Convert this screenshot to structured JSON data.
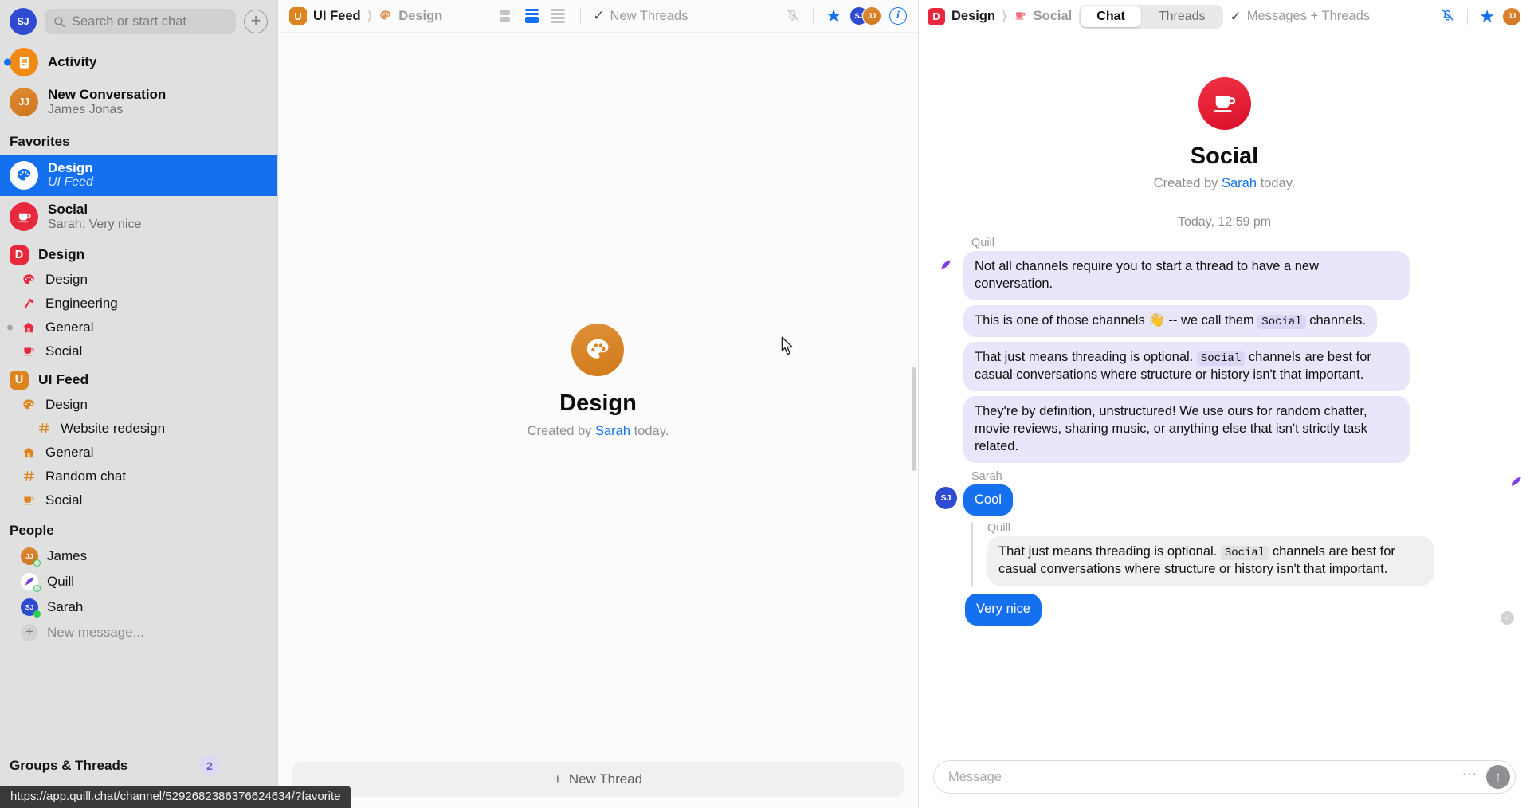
{
  "sidebar": {
    "user_avatar": "SJ",
    "search": {
      "placeholder": "Search or start chat",
      "icon": "search-icon"
    },
    "new_button": "+",
    "activity": {
      "label": "Activity",
      "icon": "activity-icon",
      "unread": true
    },
    "new_conversation": {
      "title": "New Conversation",
      "subtitle": "James Jonas",
      "avatar": "JJ"
    },
    "favorites_header": "Favorites",
    "favorites": [
      {
        "title": "Design",
        "subtitle": "UI Feed",
        "icon": "palette-icon",
        "selected": true
      },
      {
        "title": "Social",
        "subtitle": "Sarah: Very nice",
        "icon": "coffee-icon",
        "selected": false
      }
    ],
    "workspaces": [
      {
        "name": "Design",
        "badge": "D",
        "color": "#e8283c",
        "channels": [
          {
            "label": "Design",
            "icon": "palette-icon",
            "indent": false,
            "unread": false
          },
          {
            "label": "Engineering",
            "icon": "hammer-icon",
            "indent": false,
            "unread": false
          },
          {
            "label": "General",
            "icon": "home-icon",
            "indent": false,
            "unread": true
          },
          {
            "label": "Social",
            "icon": "coffee-icon",
            "indent": false,
            "unread": false
          }
        ]
      },
      {
        "name": "UI Feed",
        "badge": "U",
        "color": "#dd8420",
        "channels": [
          {
            "label": "Design",
            "icon": "palette-icon",
            "indent": false,
            "unread": false
          },
          {
            "label": "Website redesign",
            "icon": "hash-icon",
            "indent": true,
            "unread": false
          },
          {
            "label": "General",
            "icon": "home-icon",
            "indent": false,
            "unread": false
          },
          {
            "label": "Random chat",
            "icon": "hash-icon",
            "indent": false,
            "unread": false
          },
          {
            "label": "Social",
            "icon": "coffee-icon",
            "indent": false,
            "unread": false
          }
        ]
      }
    ],
    "people_header": "People",
    "people": [
      {
        "name": "James",
        "avatar": "JJ",
        "presence": "away"
      },
      {
        "name": "Quill",
        "avatar": "",
        "presence": "away"
      },
      {
        "name": "Sarah",
        "avatar": "SJ",
        "presence": "online"
      }
    ],
    "new_message": "New message...",
    "groups_threads": {
      "label": "Groups & Threads",
      "badge": "2"
    },
    "status_url": "https://app.quill.chat/channel/5292682386376624634/?favorite"
  },
  "center": {
    "breadcrumb": [
      {
        "label": "UI Feed",
        "badge": "U",
        "color": "#dd8420",
        "dim": false
      },
      {
        "label": "Design",
        "icon": "palette-icon",
        "dim": true
      }
    ],
    "layout_icons": [
      "layout-grid-icon",
      "layout-split-icon",
      "layout-list-icon"
    ],
    "filter": {
      "label": "New Threads",
      "icon": "check-icon"
    },
    "bell_icon": "bell-off-icon",
    "star_icon": "star-icon",
    "members": [
      "SJ",
      "JJ"
    ],
    "info_icon": "info-icon",
    "empty": {
      "title": "Design",
      "created_prefix": "Created by ",
      "created_by": "Sarah",
      "created_suffix": " today.",
      "icon": "palette-icon"
    },
    "new_thread_button": "New Thread"
  },
  "right": {
    "breadcrumb": [
      {
        "label": "Design",
        "badge": "D",
        "color": "#e8283c",
        "dim": false
      },
      {
        "label": "Social",
        "icon": "coffee-icon",
        "dim": true
      }
    ],
    "tabs": [
      {
        "label": "Chat",
        "active": true
      },
      {
        "label": "Threads",
        "active": false
      }
    ],
    "filter": {
      "label": "Messages + Threads",
      "icon": "check-icon"
    },
    "bell_icon": "bell-off-icon",
    "star_icon": "star-icon",
    "members": [
      "JJ"
    ],
    "channel": {
      "name": "Social",
      "icon": "coffee-icon",
      "created_prefix": "Created by ",
      "created_by": "Sarah",
      "created_suffix": " today."
    },
    "daystamp": "Today, 12:59 pm",
    "messages": [
      {
        "sender": "Quill",
        "avatar": "quill",
        "style": "lilac",
        "bubbles": [
          {
            "parts": [
              {
                "t": "Not all channels require you to start a thread to have a new conversation.",
                "code": false
              }
            ]
          },
          {
            "parts": [
              {
                "t": "This is one of those channels 👋 -- we call them ",
                "code": false
              },
              {
                "t": "Social",
                "code": true
              },
              {
                "t": " channels.",
                "code": false
              }
            ]
          },
          {
            "parts": [
              {
                "t": "That just means threading is optional. ",
                "code": false
              },
              {
                "t": "Social",
                "code": true
              },
              {
                "t": " channels are best for casual conversations where structure or history isn't that important.",
                "code": false
              }
            ]
          },
          {
            "parts": [
              {
                "t": "They're by definition, unstructured! We use ours for random chatter, movie reviews, sharing music, or anything else that isn't strictly task related.",
                "code": false
              }
            ]
          }
        ]
      },
      {
        "sender": "Sarah",
        "avatar": "SJ",
        "style": "blue",
        "bubbles": [
          {
            "parts": [
              {
                "t": "Cool",
                "code": false
              }
            ]
          }
        ]
      }
    ],
    "quoted": {
      "sender": "Quill",
      "parts": [
        {
          "t": "That just means threading is optional. ",
          "code": false
        },
        {
          "t": "Social",
          "code": true
        },
        {
          "t": " channels are best for casual conversations where structure or history isn't that important.",
          "code": false
        }
      ]
    },
    "last_reply": {
      "text": "Very nice",
      "read_receipt": "✓"
    },
    "composer": {
      "placeholder": "Message",
      "more_icon": "more-icon",
      "send_icon": "send-arrow-icon"
    }
  }
}
